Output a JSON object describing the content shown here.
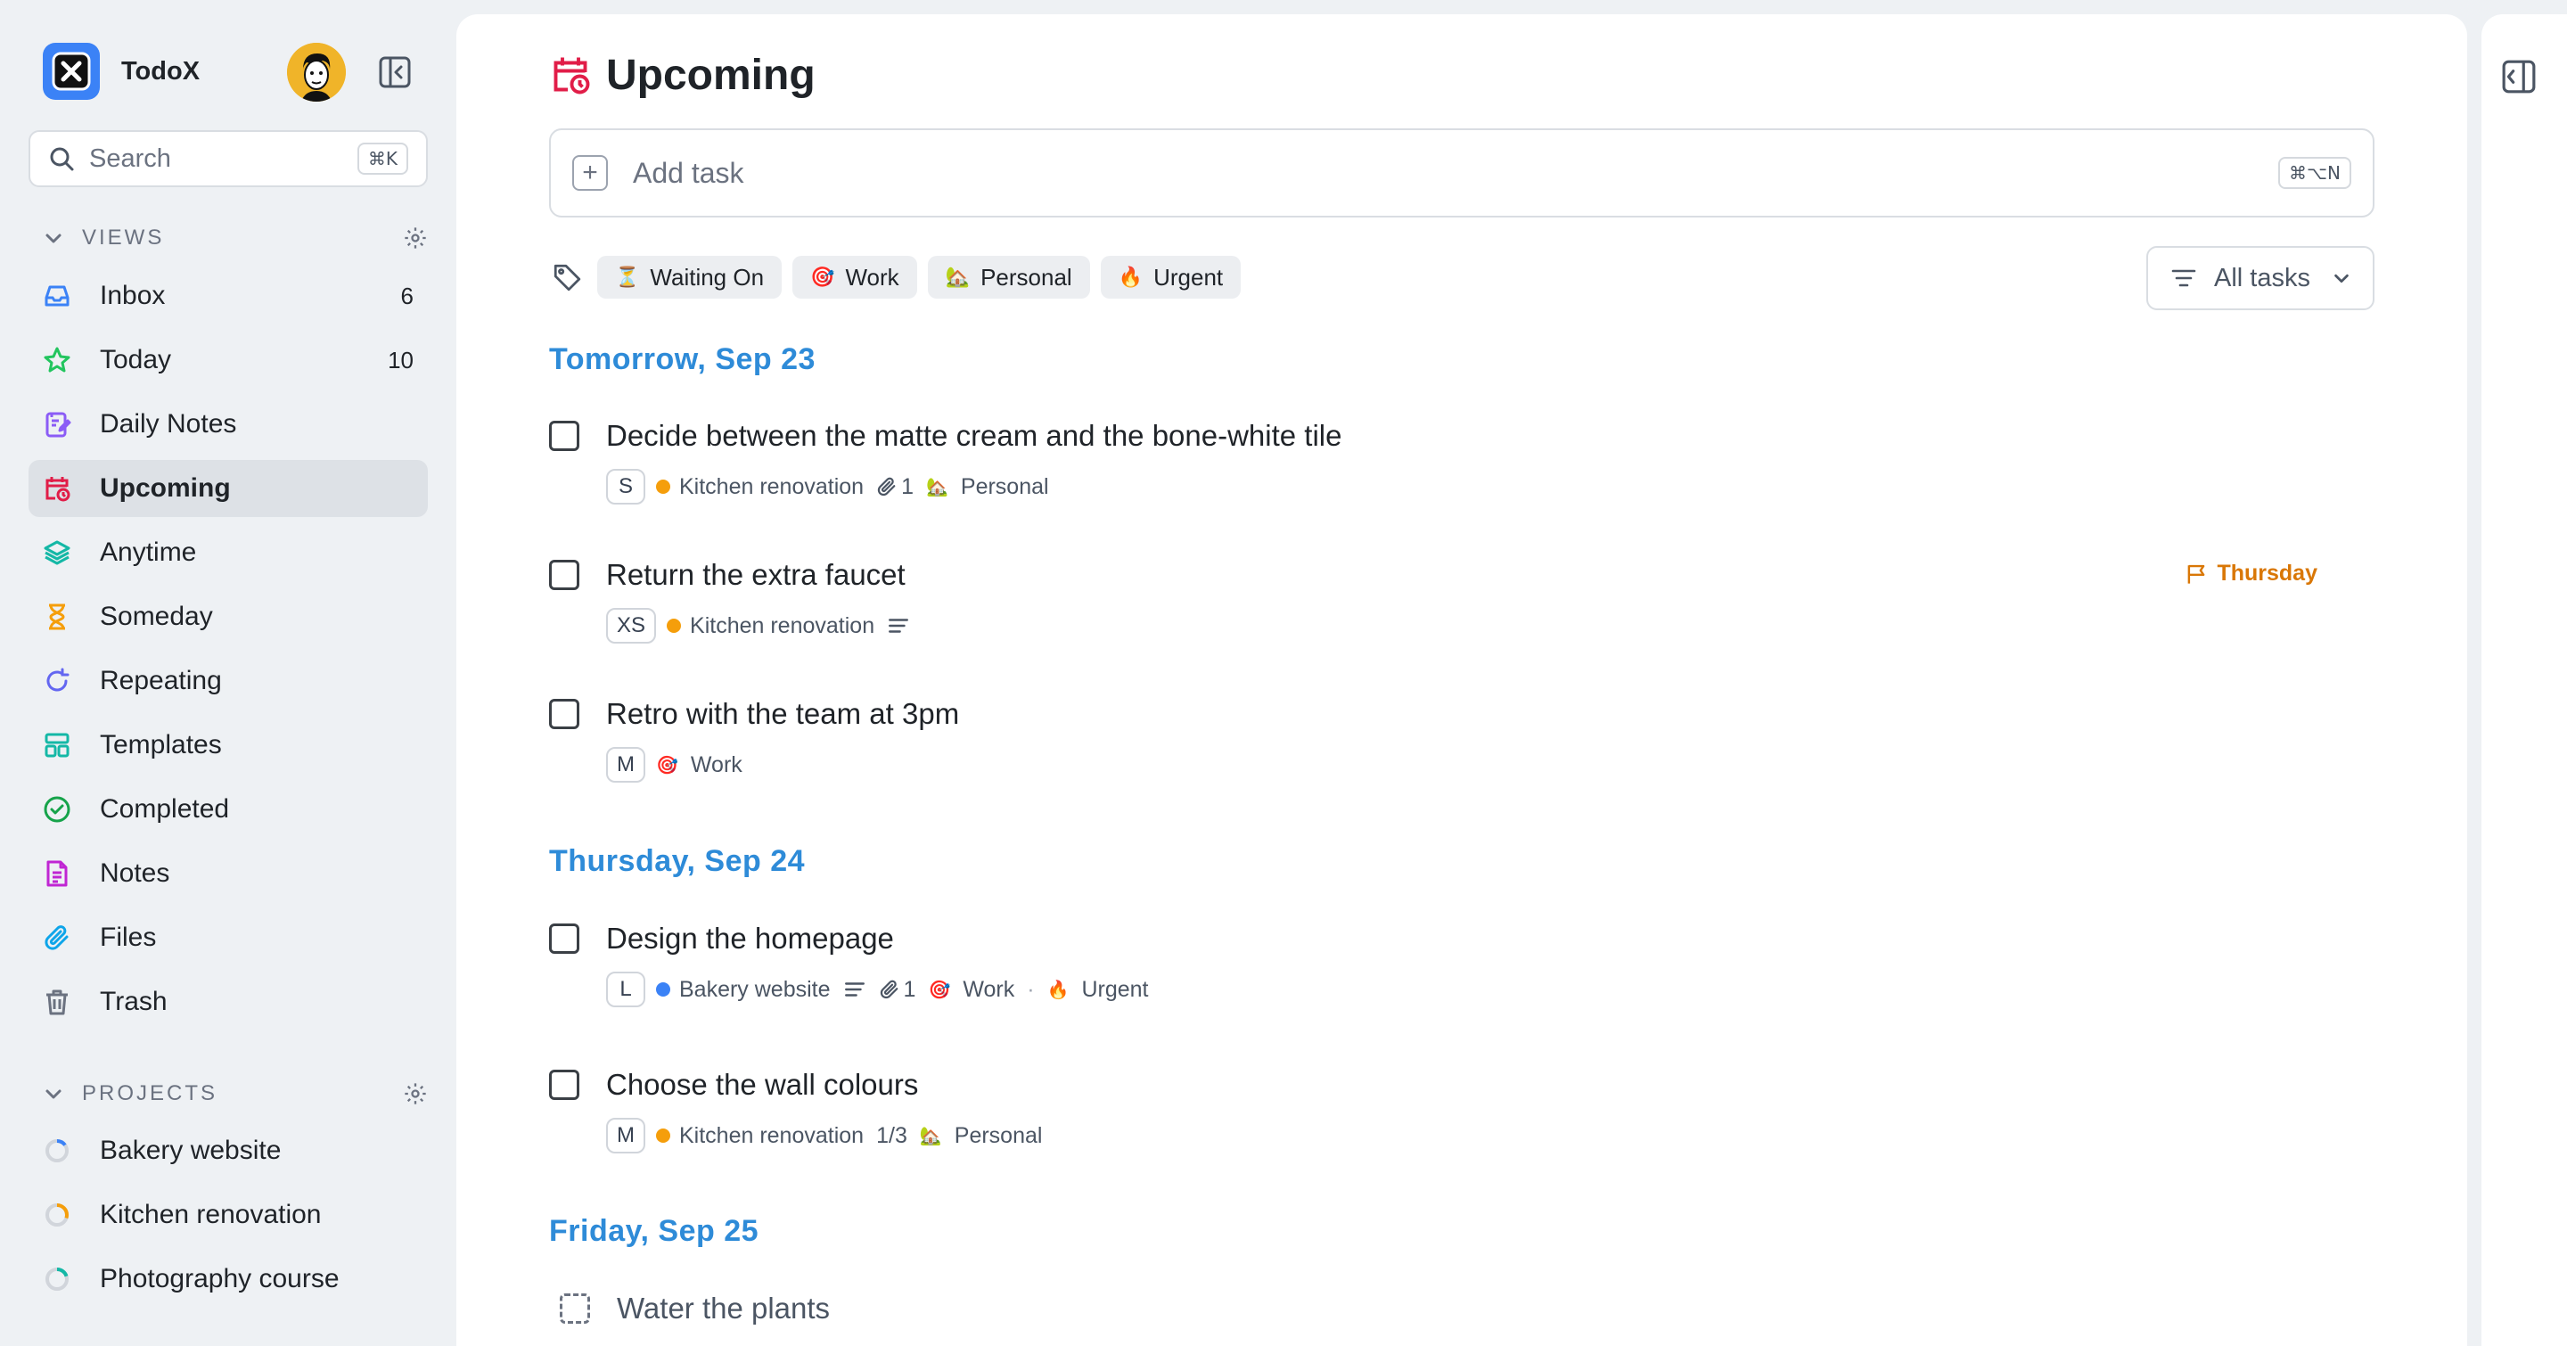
{
  "app": {
    "name": "TodoX"
  },
  "search": {
    "placeholder": "Search",
    "shortcut": "⌘K"
  },
  "views": {
    "heading": "VIEWS",
    "items": [
      {
        "label": "Inbox",
        "count": "6",
        "icon": "inbox-icon",
        "color": "#3b82f6"
      },
      {
        "label": "Today",
        "count": "10",
        "icon": "star-icon",
        "color": "#22c55e"
      },
      {
        "label": "Daily Notes",
        "count": "",
        "icon": "daily-notes-icon",
        "color": "#8b5cf6"
      },
      {
        "label": "Upcoming",
        "count": "",
        "icon": "calendar-clock-icon",
        "color": "#e11d48",
        "active": true
      },
      {
        "label": "Anytime",
        "count": "",
        "icon": "layers-icon",
        "color": "#14b8a6"
      },
      {
        "label": "Someday",
        "count": "",
        "icon": "hourglass-icon",
        "color": "#f59e0b"
      },
      {
        "label": "Repeating",
        "count": "",
        "icon": "repeat-icon",
        "color": "#6366f1"
      },
      {
        "label": "Templates",
        "count": "",
        "icon": "templates-icon",
        "color": "#14b8a6"
      },
      {
        "label": "Completed",
        "count": "",
        "icon": "check-circle-icon",
        "color": "#16a34a"
      },
      {
        "label": "Notes",
        "count": "",
        "icon": "note-icon",
        "color": "#c026d3"
      },
      {
        "label": "Files",
        "count": "",
        "icon": "paperclip-icon",
        "color": "#0ea5e9"
      },
      {
        "label": "Trash",
        "count": "",
        "icon": "trash-icon",
        "color": "#6b7280"
      }
    ]
  },
  "projects": {
    "heading": "PROJECTS",
    "items": [
      {
        "label": "Bakery website",
        "color": "#3b82f6",
        "progress": 0.15
      },
      {
        "label": "Kitchen renovation",
        "color": "#f59e0b",
        "progress": 0.3
      },
      {
        "label": "Photography course",
        "color": "#14b8a6",
        "progress": 0.2
      }
    ]
  },
  "main": {
    "title": "Upcoming",
    "add_task": {
      "placeholder": "Add task",
      "shortcut": "⌘⌥N"
    },
    "tags": [
      {
        "label": "Waiting On",
        "emoji": "⏳"
      },
      {
        "label": "Work",
        "emoji": "🎯"
      },
      {
        "label": "Personal",
        "emoji": "🏡"
      },
      {
        "label": "Urgent",
        "emoji": "🔥"
      }
    ],
    "filter": {
      "label": "All tasks"
    },
    "days": [
      {
        "heading": "Tomorrow, Sep 23",
        "tasks": [
          {
            "title": "Decide between the matte cream and the bone-white tile",
            "size": "S",
            "project": "Kitchen renovation",
            "project_color": "#f59e0b",
            "attachments": "1",
            "tag": "Personal",
            "tag_emoji": "🏡"
          },
          {
            "title": "Return the extra faucet",
            "size": "XS",
            "project": "Kitchen renovation",
            "project_color": "#f59e0b",
            "due": "Thursday"
          },
          {
            "title": "Retro with the team at 3pm",
            "size": "M",
            "tag": "Work",
            "tag_emoji": "🎯"
          }
        ]
      },
      {
        "heading": "Thursday, Sep 24",
        "tasks": [
          {
            "title": "Design the homepage",
            "size": "L",
            "project": "Bakery website",
            "project_color": "#3b82f6",
            "attachments": "1",
            "tag": "Work",
            "tag_emoji": "🎯",
            "tag2": "Urgent",
            "tag2_emoji": "🔥"
          },
          {
            "title": "Choose the wall colours",
            "size": "M",
            "project": "Kitchen renovation",
            "project_color": "#f59e0b",
            "subtasks": "1/3",
            "tag": "Personal",
            "tag_emoji": "🏡"
          }
        ]
      },
      {
        "heading": "Friday, Sep 25",
        "tasks": [
          {
            "title": "Water the plants"
          }
        ]
      }
    ]
  }
}
